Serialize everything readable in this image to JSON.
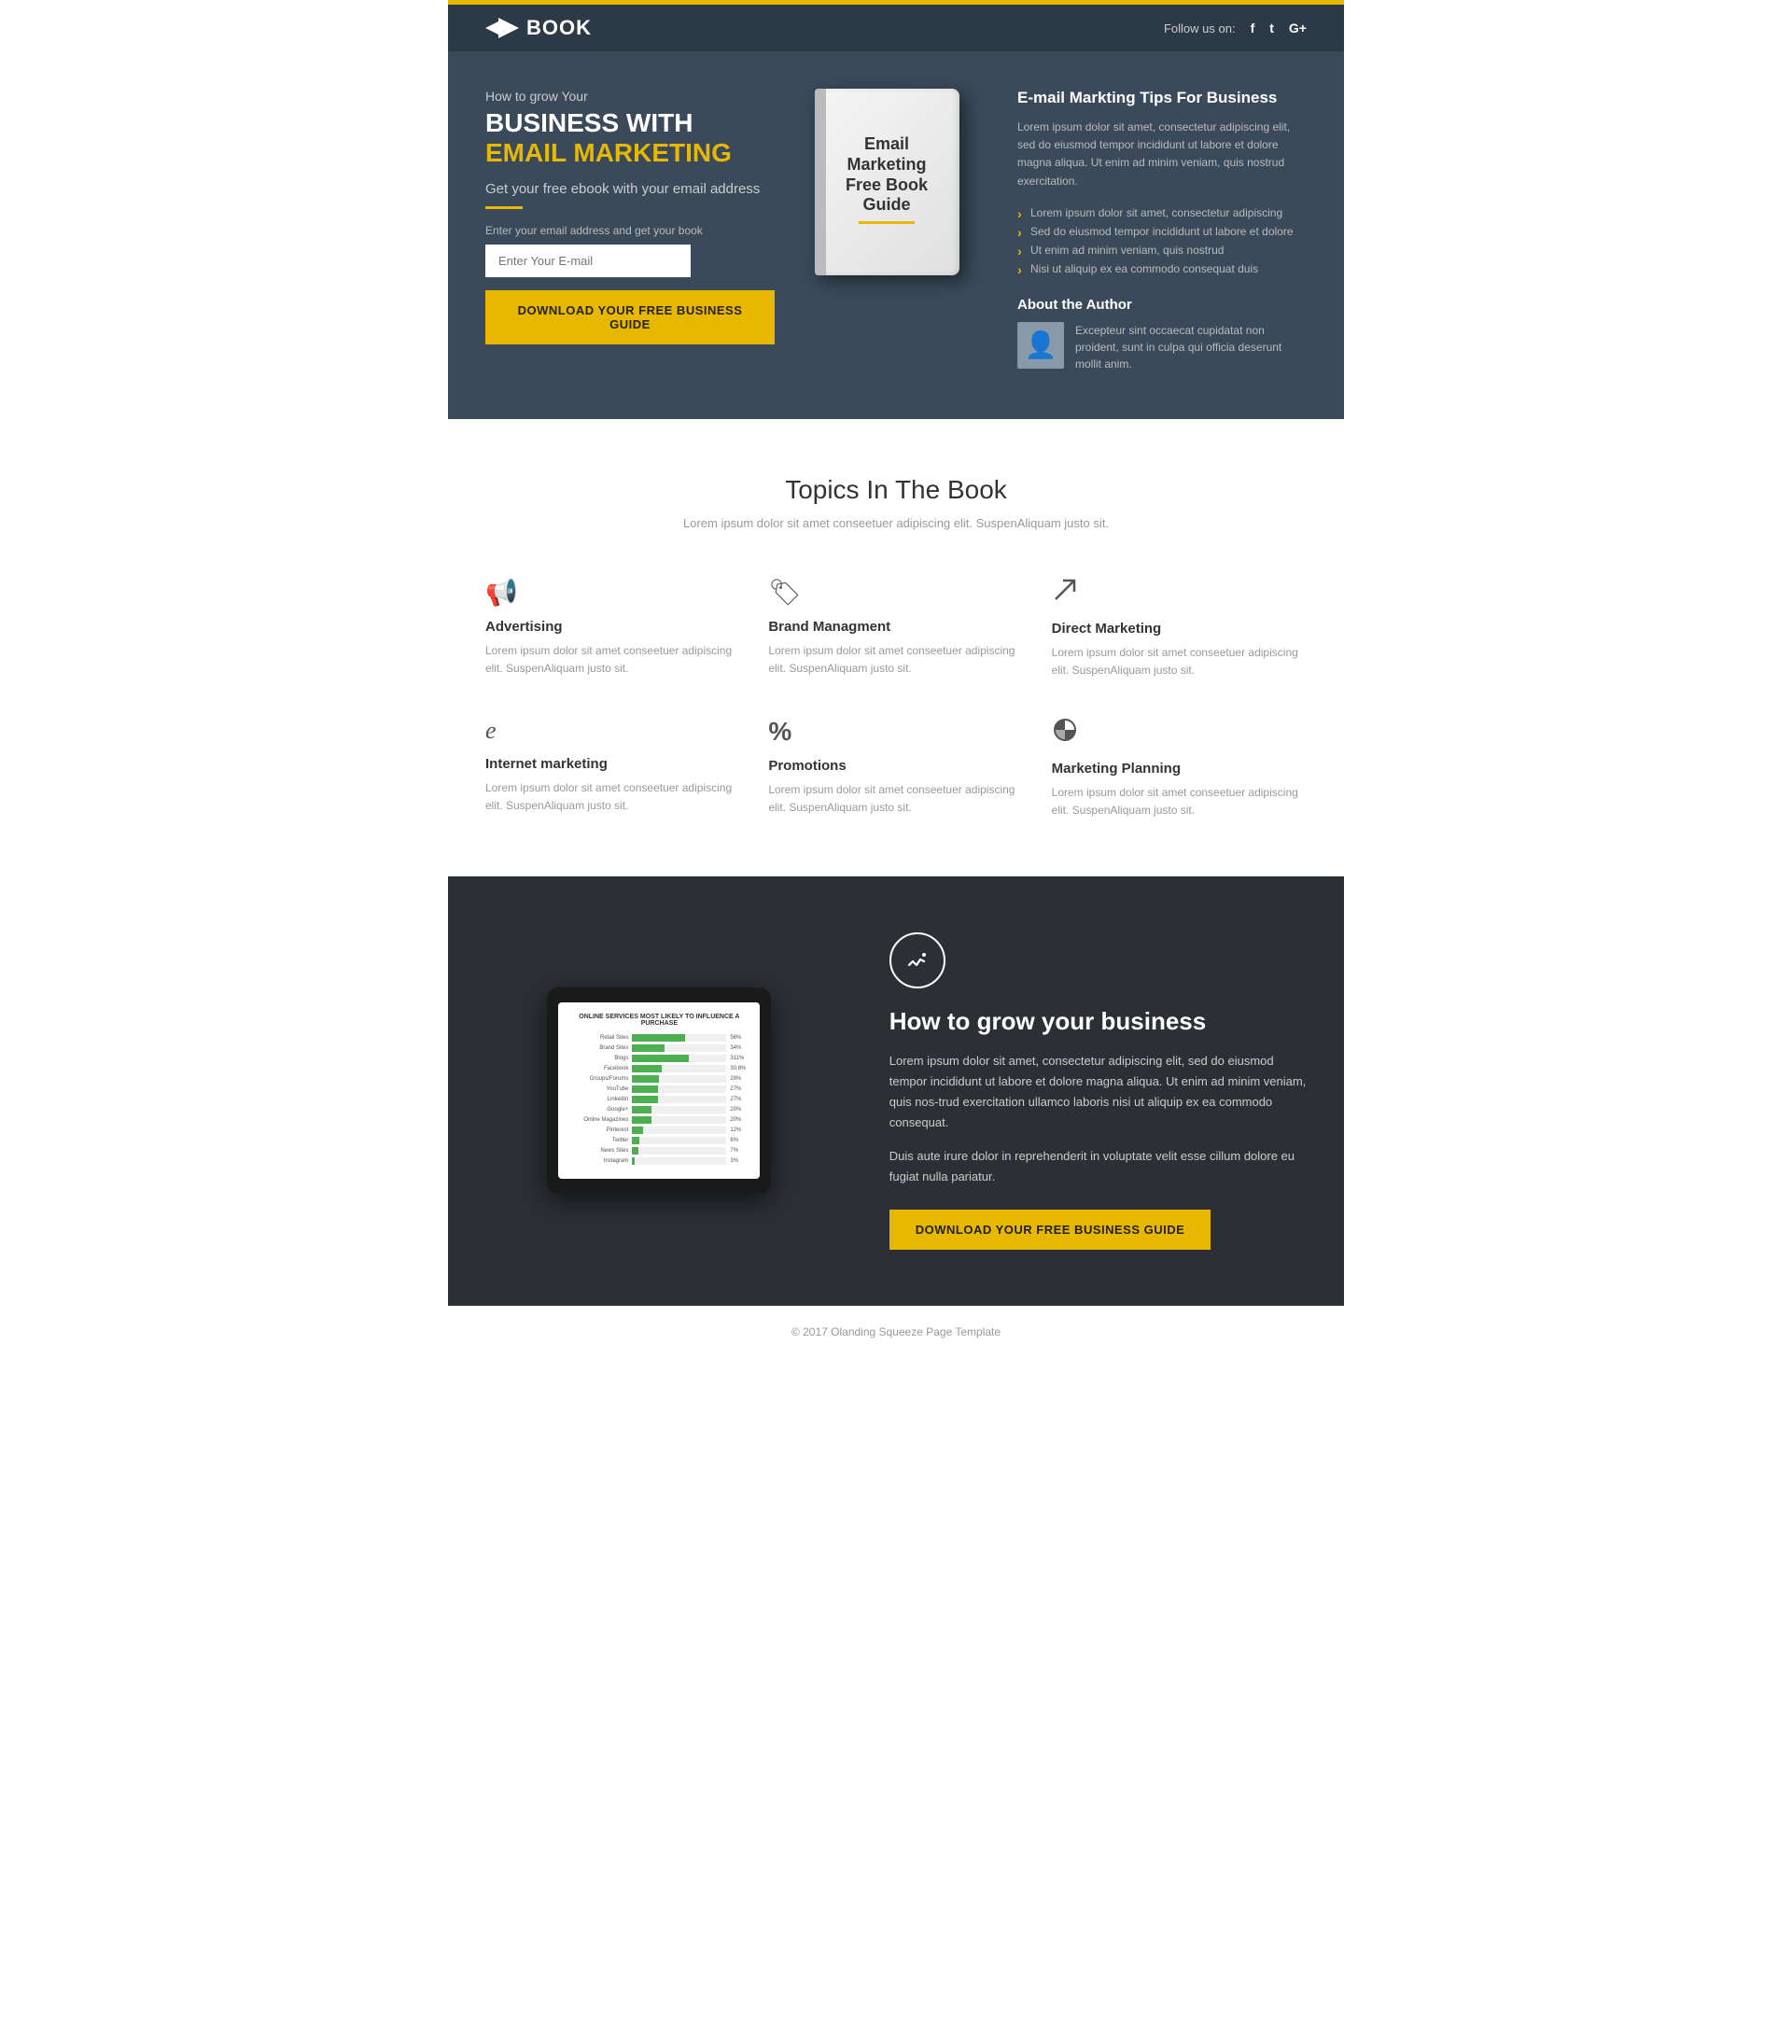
{
  "topBar": {
    "color": "#e8b800"
  },
  "nav": {
    "logo": "BOOK",
    "followUs": "Follow us on:",
    "social": [
      "f",
      "t",
      "G+"
    ]
  },
  "hero": {
    "subtitle": "How to grow Your",
    "titleMain": "BUSINESS WITH",
    "titleHighlight": "EMAIL MARKETING",
    "desc": "Get your free ebook with your email address",
    "emailLabel": "Enter your email address and get your book",
    "emailPlaceholder": "Enter Your E-mail",
    "downloadBtn": "Download Your Free Business Guide"
  },
  "book": {
    "line1": "Email",
    "line2": "Marketing",
    "line3": "Free Book",
    "line4": "Guide"
  },
  "rightPanel": {
    "title": "E-mail Markting Tips For Business",
    "body": "Lorem ipsum dolor sit amet, consectetur adipiscing elit, sed do eiusmod tempor incididunt ut labore et dolore magna aliqua. Ut enim ad minim veniam, quis nostrud exercitation.",
    "bullets": [
      "Lorem ipsum dolor sit amet, consectetur adipiscing",
      "Sed do eiusmod tempor incididunt ut labore et dolore",
      "Ut enim ad minim veniam, quis nostrud",
      "Nisi ut aliquip ex ea commodo consequat duis"
    ],
    "aboutTitle": "About the Author",
    "authorText": "Excepteur sint occaecat cupidatat non proident, sunt in culpa qui officia deserunt mollit anim."
  },
  "topics": {
    "sectionTitle": "Topics In The Book",
    "sectionDesc": "Lorem ipsum dolor sit amet conseetuer adipiscing elit. SuspenAliquam justo sit.",
    "items": [
      {
        "icon": "📢",
        "name": "Advertising",
        "text": "Lorem ipsum dolor sit amet conseetuer adipiscing elit. SuspenAliquam justo sit."
      },
      {
        "icon": "🏷",
        "name": "Brand Managment",
        "text": "Lorem ipsum dolor sit amet conseetuer adipiscing elit. SuspenAliquam justo sit."
      },
      {
        "icon": "↗",
        "name": "Direct Marketing",
        "text": "Lorem ipsum dolor sit amet conseetuer adipiscing elit. SuspenAliquam justo sit."
      },
      {
        "icon": "e",
        "name": "Internet marketing",
        "text": "Lorem ipsum dolor sit amet conseetuer adipiscing elit. SuspenAliquam justo sit."
      },
      {
        "icon": "%",
        "name": "Promotions",
        "text": "Lorem ipsum dolor sit amet conseetuer adipiscing elit. SuspenAliquam justo sit."
      },
      {
        "icon": "◕",
        "name": "Marketing Planning",
        "text": "Lorem ipsum dolor sit amet conseetuer adipiscing elit. SuspenAliquam justo sit."
      }
    ]
  },
  "chartSection": {
    "chartTitle": "ONLINE SERVICES MOST LIKELY TO INFLUENCE A PURCHASE",
    "bars": [
      {
        "label": "Retail Sites",
        "pct": "56%",
        "val": 56
      },
      {
        "label": "Brand Sites",
        "pct": "34%",
        "val": 34
      },
      {
        "label": "Blogs",
        "pct": "311%",
        "val": 62
      },
      {
        "label": "Facebook",
        "pct": "30.8%",
        "val": 31
      },
      {
        "label": "Groups/Forums",
        "pct": "28%",
        "val": 28
      },
      {
        "label": "YouTube",
        "pct": "27%",
        "val": 27
      },
      {
        "label": "LinkedIn",
        "pct": "27%",
        "val": 27
      },
      {
        "label": "Google+",
        "pct": "20%",
        "val": 20
      },
      {
        "label": "Online Magazines",
        "pct": "20%",
        "val": 20
      },
      {
        "label": "Pinterest",
        "pct": "12%",
        "val": 12
      },
      {
        "label": "Twitter",
        "pct": "8%",
        "val": 8
      },
      {
        "label": "News Sites",
        "pct": "7%",
        "val": 7
      },
      {
        "label": "Instagram",
        "pct": "3%",
        "val": 3
      }
    ],
    "growTitle": "How to grow your business",
    "growText1": "Lorem ipsum dolor sit amet, consectetur adipiscing elit, sed do eiusmod tempor incididunt ut labore et dolore magna aliqua. Ut enim ad minim veniam, quis nos-trud exercitation ullamco laboris nisi ut aliquip ex ea commodo consequat.",
    "growText2": "Duis aute irure dolor in reprehenderit in voluptate velit esse cillum dolore eu fugiat nulla pariatur.",
    "downloadBtn": "Download Your Free Business Guide"
  },
  "footer": {
    "text": "© 2017 Olanding Squeeze Page Template"
  }
}
